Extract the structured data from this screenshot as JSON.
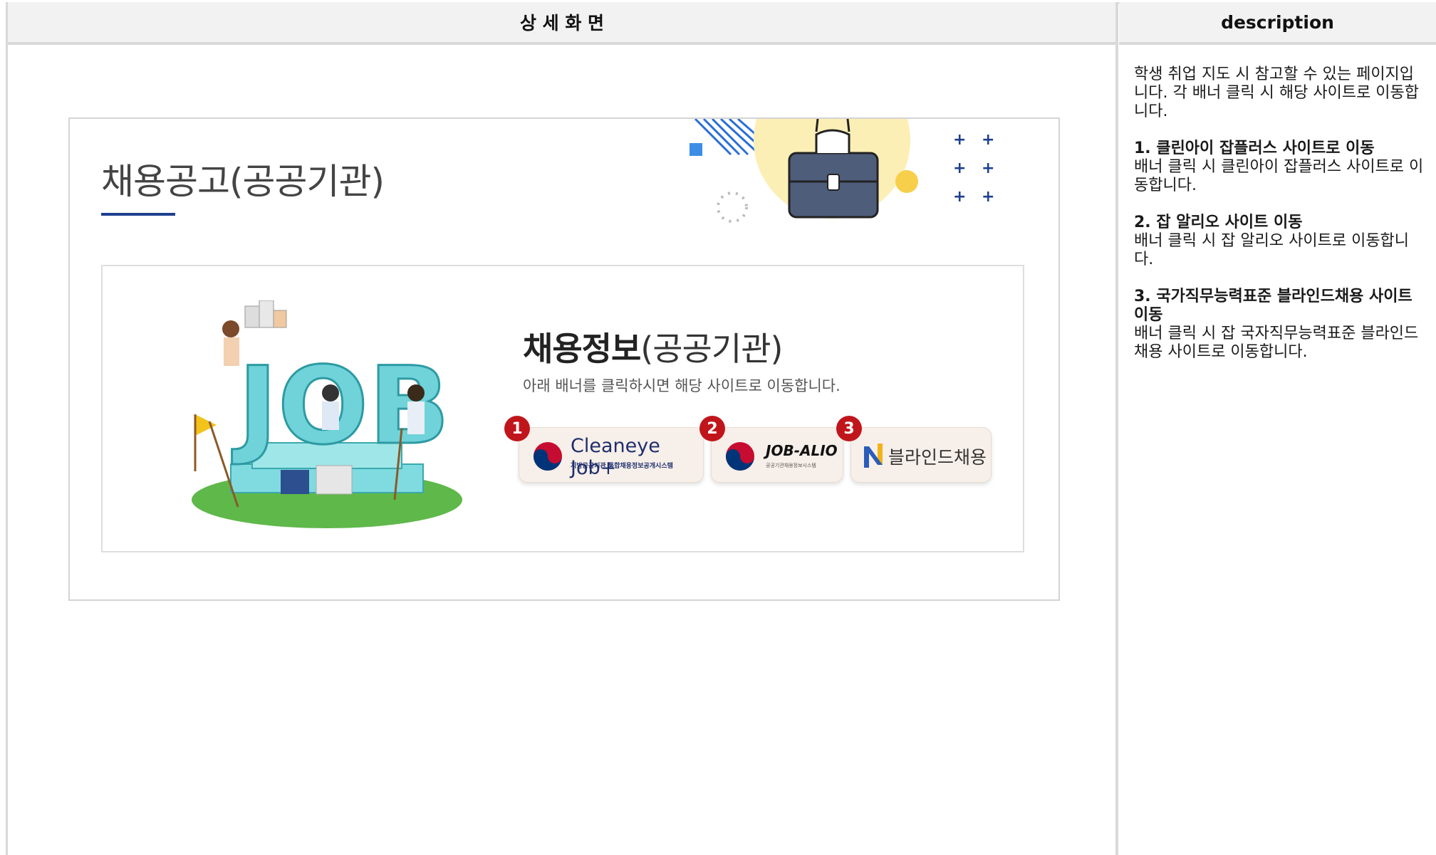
{
  "headers": {
    "left": "상 세 화 면",
    "right": "description"
  },
  "description": {
    "intro": "학생 취업 지도 시 참고할 수 있는 페이지입니다. 각 배너 클릭 시 해당 사이트로 이동합니다.",
    "items": [
      {
        "title": "1. 클린아이 잡플러스 사이트로 이동",
        "body": "배너 클릭 시 클린아이 잡플러스 사이트로 이동합니다."
      },
      {
        "title": "2. 잡 알리오 사이트  이동",
        "body": "배너 클릭 시 잡 알리오 사이트로 이동합니다."
      },
      {
        "title": "3. 국가직무능력표준 블라인드채용 사이트 이동",
        "body": "배너 클릭 시 잡 국자직무능력표준 블라인드채용 사이트로 이동합니다."
      }
    ]
  },
  "mock": {
    "page_title": "채용공고(공공기관)",
    "inner_title_bold": "채용정보",
    "inner_title_light": "(공공기관)",
    "inner_subtitle": "아래 배너를 클릭하시면 해당 사이트로 이동합니다.",
    "illustration_text": "JOB",
    "banners": [
      {
        "badge": "1",
        "name": "Cleaneye Job+",
        "sub": "지방공공기관 통합채용정보공개시스템"
      },
      {
        "badge": "2",
        "name": "JOB-ALIO",
        "sub": "공공기관채용정보시스템"
      },
      {
        "badge": "3",
        "name": "블라인드채용"
      }
    ]
  },
  "colors": {
    "badge": "#c0161b",
    "accent_underline": "#1e3f8f",
    "header_bg": "#f2f2f2",
    "divider": "#d9d9d9"
  }
}
